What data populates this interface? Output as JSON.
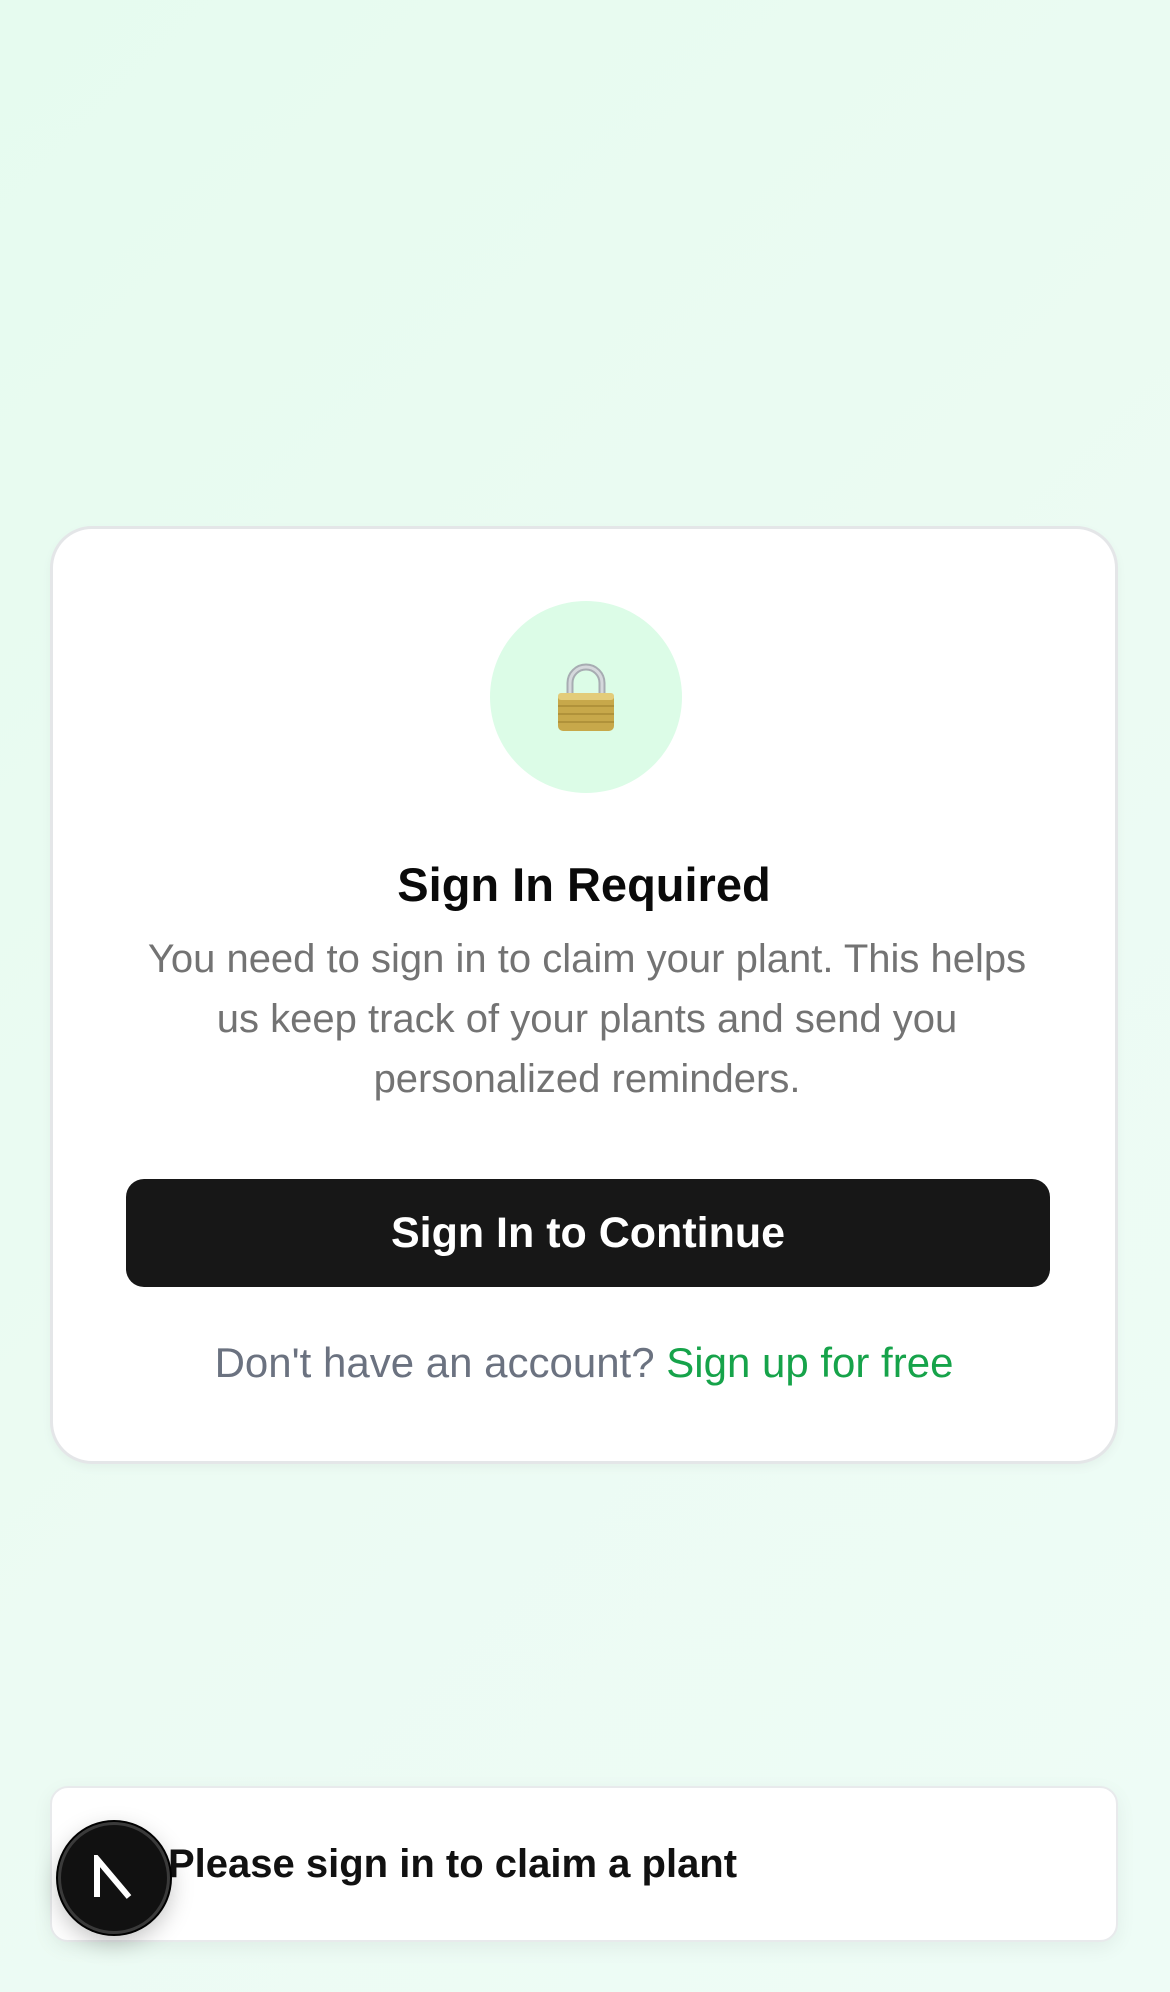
{
  "card": {
    "icon": "lock-icon",
    "title": "Sign In Required",
    "description": "You need to sign in to claim your plant. This helps us keep track of your plants and send you personalized reminders.",
    "signin_button": "Sign In to Continue",
    "signup_prompt": "Don't have an account?",
    "signup_link": "Sign up for free"
  },
  "toast": {
    "badge_icon": "nextjs-icon",
    "message": "Please sign in to claim a plant"
  },
  "colors": {
    "background": "#e9fbf1",
    "icon_circle": "#dcfce7",
    "button": "#171717",
    "link": "#16a34a",
    "muted_text": "#737373"
  }
}
